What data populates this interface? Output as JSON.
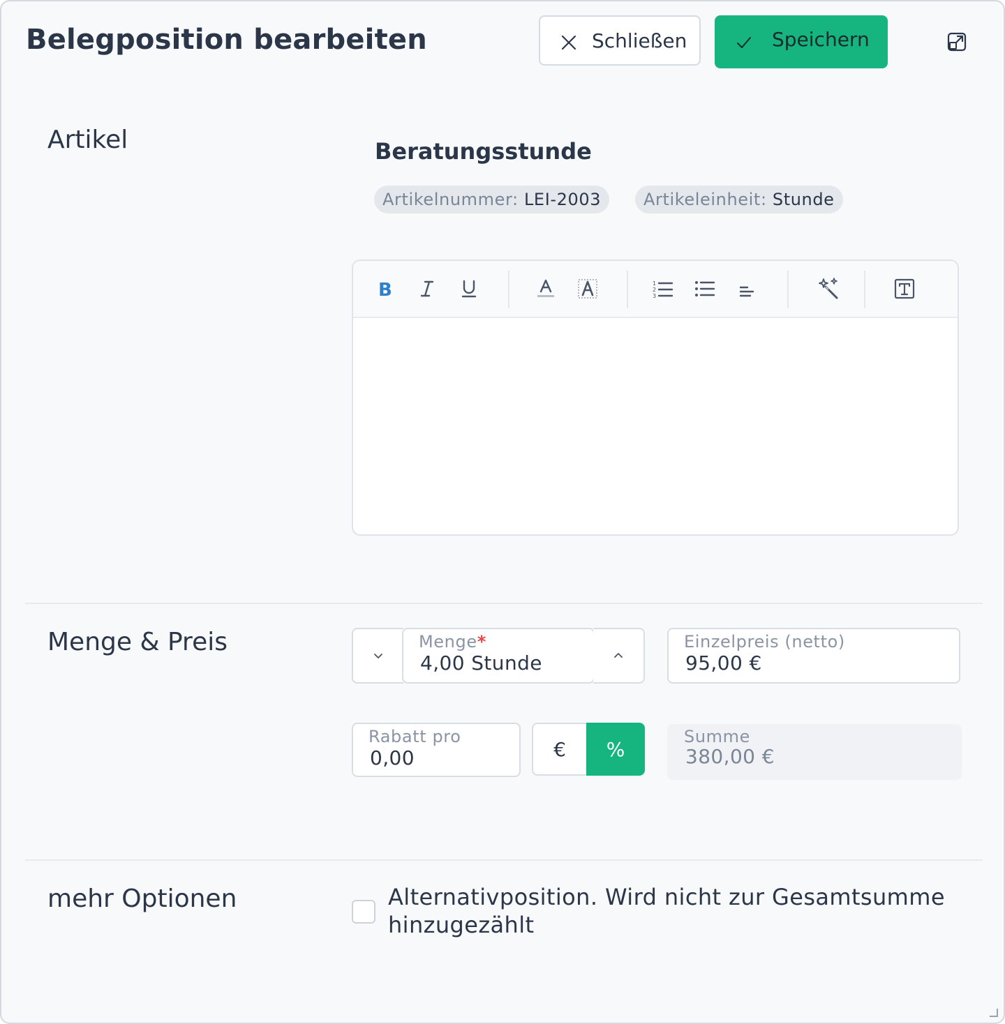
{
  "header": {
    "title": "Belegposition bearbeiten",
    "close_label": "Schließen",
    "save_label": "Speichern"
  },
  "colors": {
    "accent": "#16b47e",
    "required": "#ef4444",
    "bold_button": "#2f80c8"
  },
  "article": {
    "section_label": "Artikel",
    "name": "Beratungsstunde",
    "chips": [
      {
        "key": "Artikelnummer:",
        "value": "LEI-2003"
      },
      {
        "key": "Artikeleinheit:",
        "value": "Stunde"
      }
    ],
    "editor": {
      "content": "",
      "toolbar_icons": [
        "bold-icon",
        "italic-icon",
        "underline-icon",
        "font-color-icon",
        "highlight-icon",
        "ordered-list-icon",
        "bullet-list-icon",
        "align-icon",
        "magic-wand-icon",
        "text-format-icon"
      ]
    }
  },
  "quantity_price": {
    "section_label": "Menge & Preis",
    "quantity": {
      "label": "Menge",
      "required_mark": "*",
      "value": "4,00 Stunde"
    },
    "unit_price": {
      "label": "Einzelpreis (netto)",
      "value": "95,00 €"
    },
    "discount": {
      "label": "Rabatt pro",
      "value": "0,00"
    },
    "discount_modes": {
      "euro": "€",
      "percent": "%",
      "selected": "%"
    },
    "sum": {
      "label": "Summe",
      "value": "380,00 €"
    }
  },
  "more_options": {
    "section_label": "mehr Optionen",
    "alternative_checkbox": {
      "checked": false,
      "label": "Alternativposition. Wird nicht zur Gesamtsumme hinzugezählt"
    }
  }
}
